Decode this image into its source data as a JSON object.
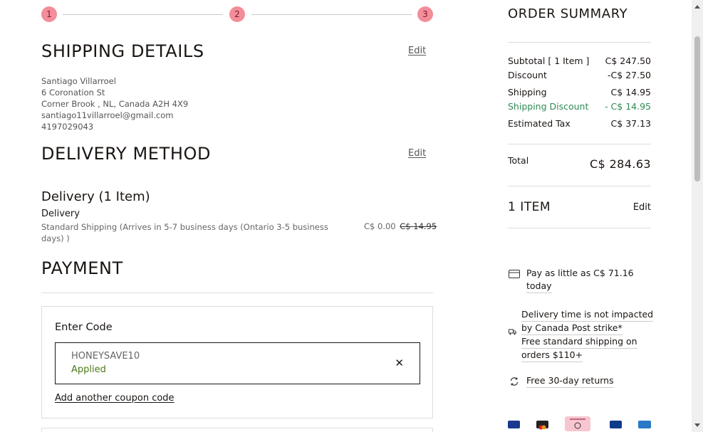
{
  "stepper": {
    "steps": [
      "1",
      "2",
      "3"
    ]
  },
  "shipping": {
    "title": "SHIPPING DETAILS",
    "edit": "Edit",
    "address": [
      "Santiago Villarroel",
      "6 Coronation St",
      "Corner Brook , NL, Canada A2H 4X9",
      "santiago11villarroel@gmail.com",
      "4197029043"
    ]
  },
  "delivery": {
    "title": "DELIVERY METHOD",
    "edit": "Edit",
    "group_title": "Delivery (1 Item)",
    "subtitle": "Delivery",
    "description": "Standard Shipping (Arrives in 5-7 business days (Ontario 3-5 business days) )",
    "price": "C$ 0.00",
    "original_price": "C$ 14.95"
  },
  "payment": {
    "title": "PAYMENT",
    "coupon_label": "Enter Code",
    "coupon_code": "HONEYSAVE10",
    "coupon_status": "Applied",
    "remove_symbol": "✕",
    "add_another": "Add another coupon code"
  },
  "summary": {
    "title": "ORDER SUMMARY",
    "rows": [
      {
        "label": "Subtotal [ 1 Item ]",
        "value": "C$ 247.50"
      },
      {
        "label": "Discount",
        "value": "-C$ 27.50"
      },
      {
        "label": "Shipping",
        "value": "C$ 14.95"
      },
      {
        "label": "Shipping Discount",
        "value": "- C$ 14.95"
      },
      {
        "label": "Estimated Tax",
        "value": "C$ 37.13"
      }
    ],
    "total_label": "Total",
    "total_value": "C$ 284.63",
    "items_label": "1 ITEM",
    "items_edit": "Edit"
  },
  "promos": {
    "installment": [
      "Pay as little as C$ 71.16",
      "today"
    ],
    "delivery": [
      "Delivery time is not impacted",
      "by Canada Post strike*",
      "Free standard shipping on",
      "orders $110+"
    ],
    "returns": [
      "Free 30-day returns"
    ]
  },
  "payment_icons": [
    "visa-icon",
    "mastercard-icon",
    "pay-by-installment-icon",
    "paypal-icon",
    "amex-icon"
  ],
  "colors": {
    "step_badge": "#f38d99",
    "applied_green": "#4c7a1a",
    "discount_green": "#2e8a55"
  }
}
